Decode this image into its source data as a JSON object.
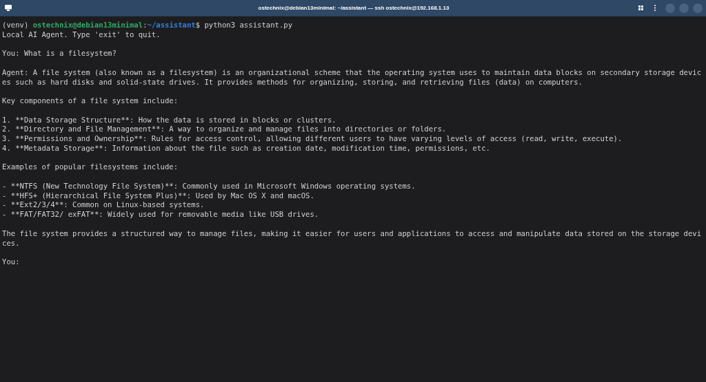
{
  "window": {
    "title": "ostechnix@debian13minimal: ~/assistant — ssh ostechnix@192.168.1.13"
  },
  "terminal": {
    "lines": [
      {
        "kind": "prompt",
        "venv": "(venv)",
        "user_host": "ostechnix@debian13minimal",
        "separator": ":",
        "path": "~/assistant",
        "symbol": "$",
        "command": "python3 assistant.py"
      },
      {
        "kind": "text",
        "text": "Local AI Agent. Type 'exit' to quit."
      },
      {
        "kind": "blank"
      },
      {
        "kind": "text",
        "text": "You: What is a filesystem?"
      },
      {
        "kind": "blank"
      },
      {
        "kind": "text",
        "text": "Agent: A file system (also known as a filesystem) is an organizational scheme that the operating system uses to maintain data blocks on secondary storage devices such as hard disks and solid-state drives. It provides methods for organizing, storing, and retrieving files (data) on computers."
      },
      {
        "kind": "blank"
      },
      {
        "kind": "text",
        "text": "Key components of a file system include:"
      },
      {
        "kind": "blank"
      },
      {
        "kind": "text",
        "text": "1. **Data Storage Structure**: How the data is stored in blocks or clusters."
      },
      {
        "kind": "text",
        "text": "2. **Directory and File Management**: A way to organize and manage files into directories or folders."
      },
      {
        "kind": "text",
        "text": "3. **Permissions and Ownership**: Rules for access control, allowing different users to have varying levels of access (read, write, execute)."
      },
      {
        "kind": "text",
        "text": "4. **Metadata Storage**: Information about the file such as creation date, modification time, permissions, etc."
      },
      {
        "kind": "blank"
      },
      {
        "kind": "text",
        "text": "Examples of popular filesystems include:"
      },
      {
        "kind": "blank"
      },
      {
        "kind": "text",
        "text": "- **NTFS (New Technology File System)**: Commonly used in Microsoft Windows operating systems."
      },
      {
        "kind": "text",
        "text": "- **HFS+ (Hierarchical File System Plus)**: Used by Mac OS X and macOS."
      },
      {
        "kind": "text",
        "text": "- **Ext2/3/4**: Common on Linux-based systems."
      },
      {
        "kind": "text",
        "text": "- **FAT/FAT32/ exFAT**: Widely used for removable media like USB drives."
      },
      {
        "kind": "blank"
      },
      {
        "kind": "text",
        "text": "The file system provides a structured way to manage files, making it easier for users and applications to access and manipulate data stored on the storage devices."
      },
      {
        "kind": "blank"
      },
      {
        "kind": "text",
        "text": "You:"
      }
    ]
  }
}
